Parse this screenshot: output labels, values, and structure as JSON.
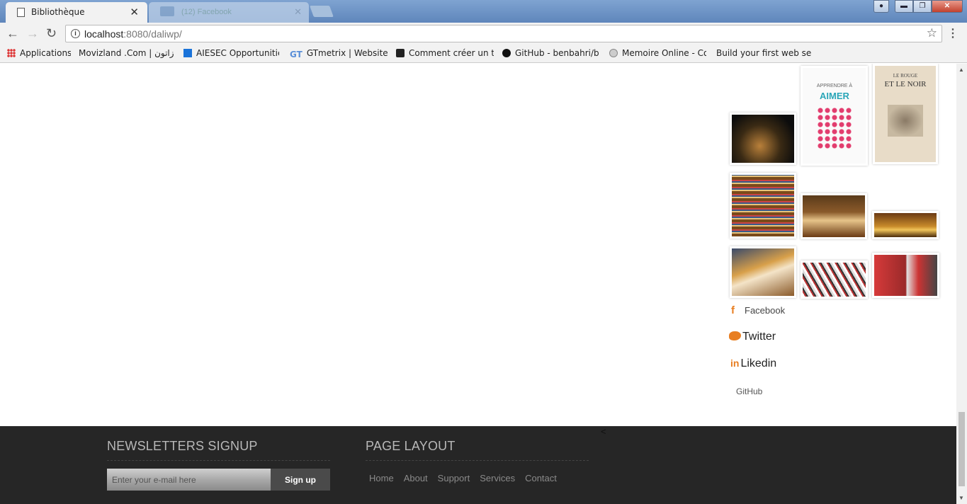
{
  "browser": {
    "active_tab": {
      "title": "Bibliothèque",
      "close": "✕"
    },
    "inactive_tab": {
      "title": "(12) Facebook",
      "close": "✕"
    },
    "window_buttons": {
      "minimize": "▬",
      "maximize": "❐",
      "close": "✕"
    },
    "url": {
      "host": "localhost",
      "path": ":8080/daliwp/"
    },
    "nav": {
      "back": "←",
      "forward": "→",
      "reload": "↻"
    },
    "star": "☆",
    "menu": "⋮"
  },
  "bookmarks": [
    {
      "label": "Applications",
      "icon": "apps-icon"
    },
    {
      "label": "Movizland .Com | زاتون",
      "icon": "page-icon"
    },
    {
      "label": "AIESEC Opportunities",
      "icon": "aiesec-icon"
    },
    {
      "label": "GTmetrix | Website Sp",
      "icon": "gtmetrix-icon"
    },
    {
      "label": "Comment créer un the",
      "icon": "wordpress-icon"
    },
    {
      "label": "GitHub - benbahri/bo",
      "icon": "github-icon"
    },
    {
      "label": "Memoire Online - Cor",
      "icon": "memoire-icon"
    },
    {
      "label": "Build your first web se",
      "icon": "page-icon"
    }
  ],
  "gallery": {
    "book_covers": [
      {
        "title": "APPRENDRE À AIMER",
        "color": "#e23d6e"
      },
      {
        "title": "LE ROUGE ET LE NOIR",
        "color": "#6b5a45"
      }
    ]
  },
  "social": {
    "facebook": "Facebook",
    "facebook_icon": "f",
    "twitter": "Twitter",
    "linkedin": "Likedin",
    "linkedin_icon": "in",
    "github": "GitHub"
  },
  "footer": {
    "newsletter_title": "NEWSLETTERS SIGNUP",
    "email_placeholder": "Enter your e-mail here",
    "signup_label": "Sign up",
    "layout_title": "PAGE LAYOUT",
    "links": [
      "Home",
      "About",
      "Support",
      "Services",
      "Contact"
    ],
    "stray": "<"
  },
  "colors": {
    "accent": "#e87e21",
    "footer_bg": "#262626"
  }
}
